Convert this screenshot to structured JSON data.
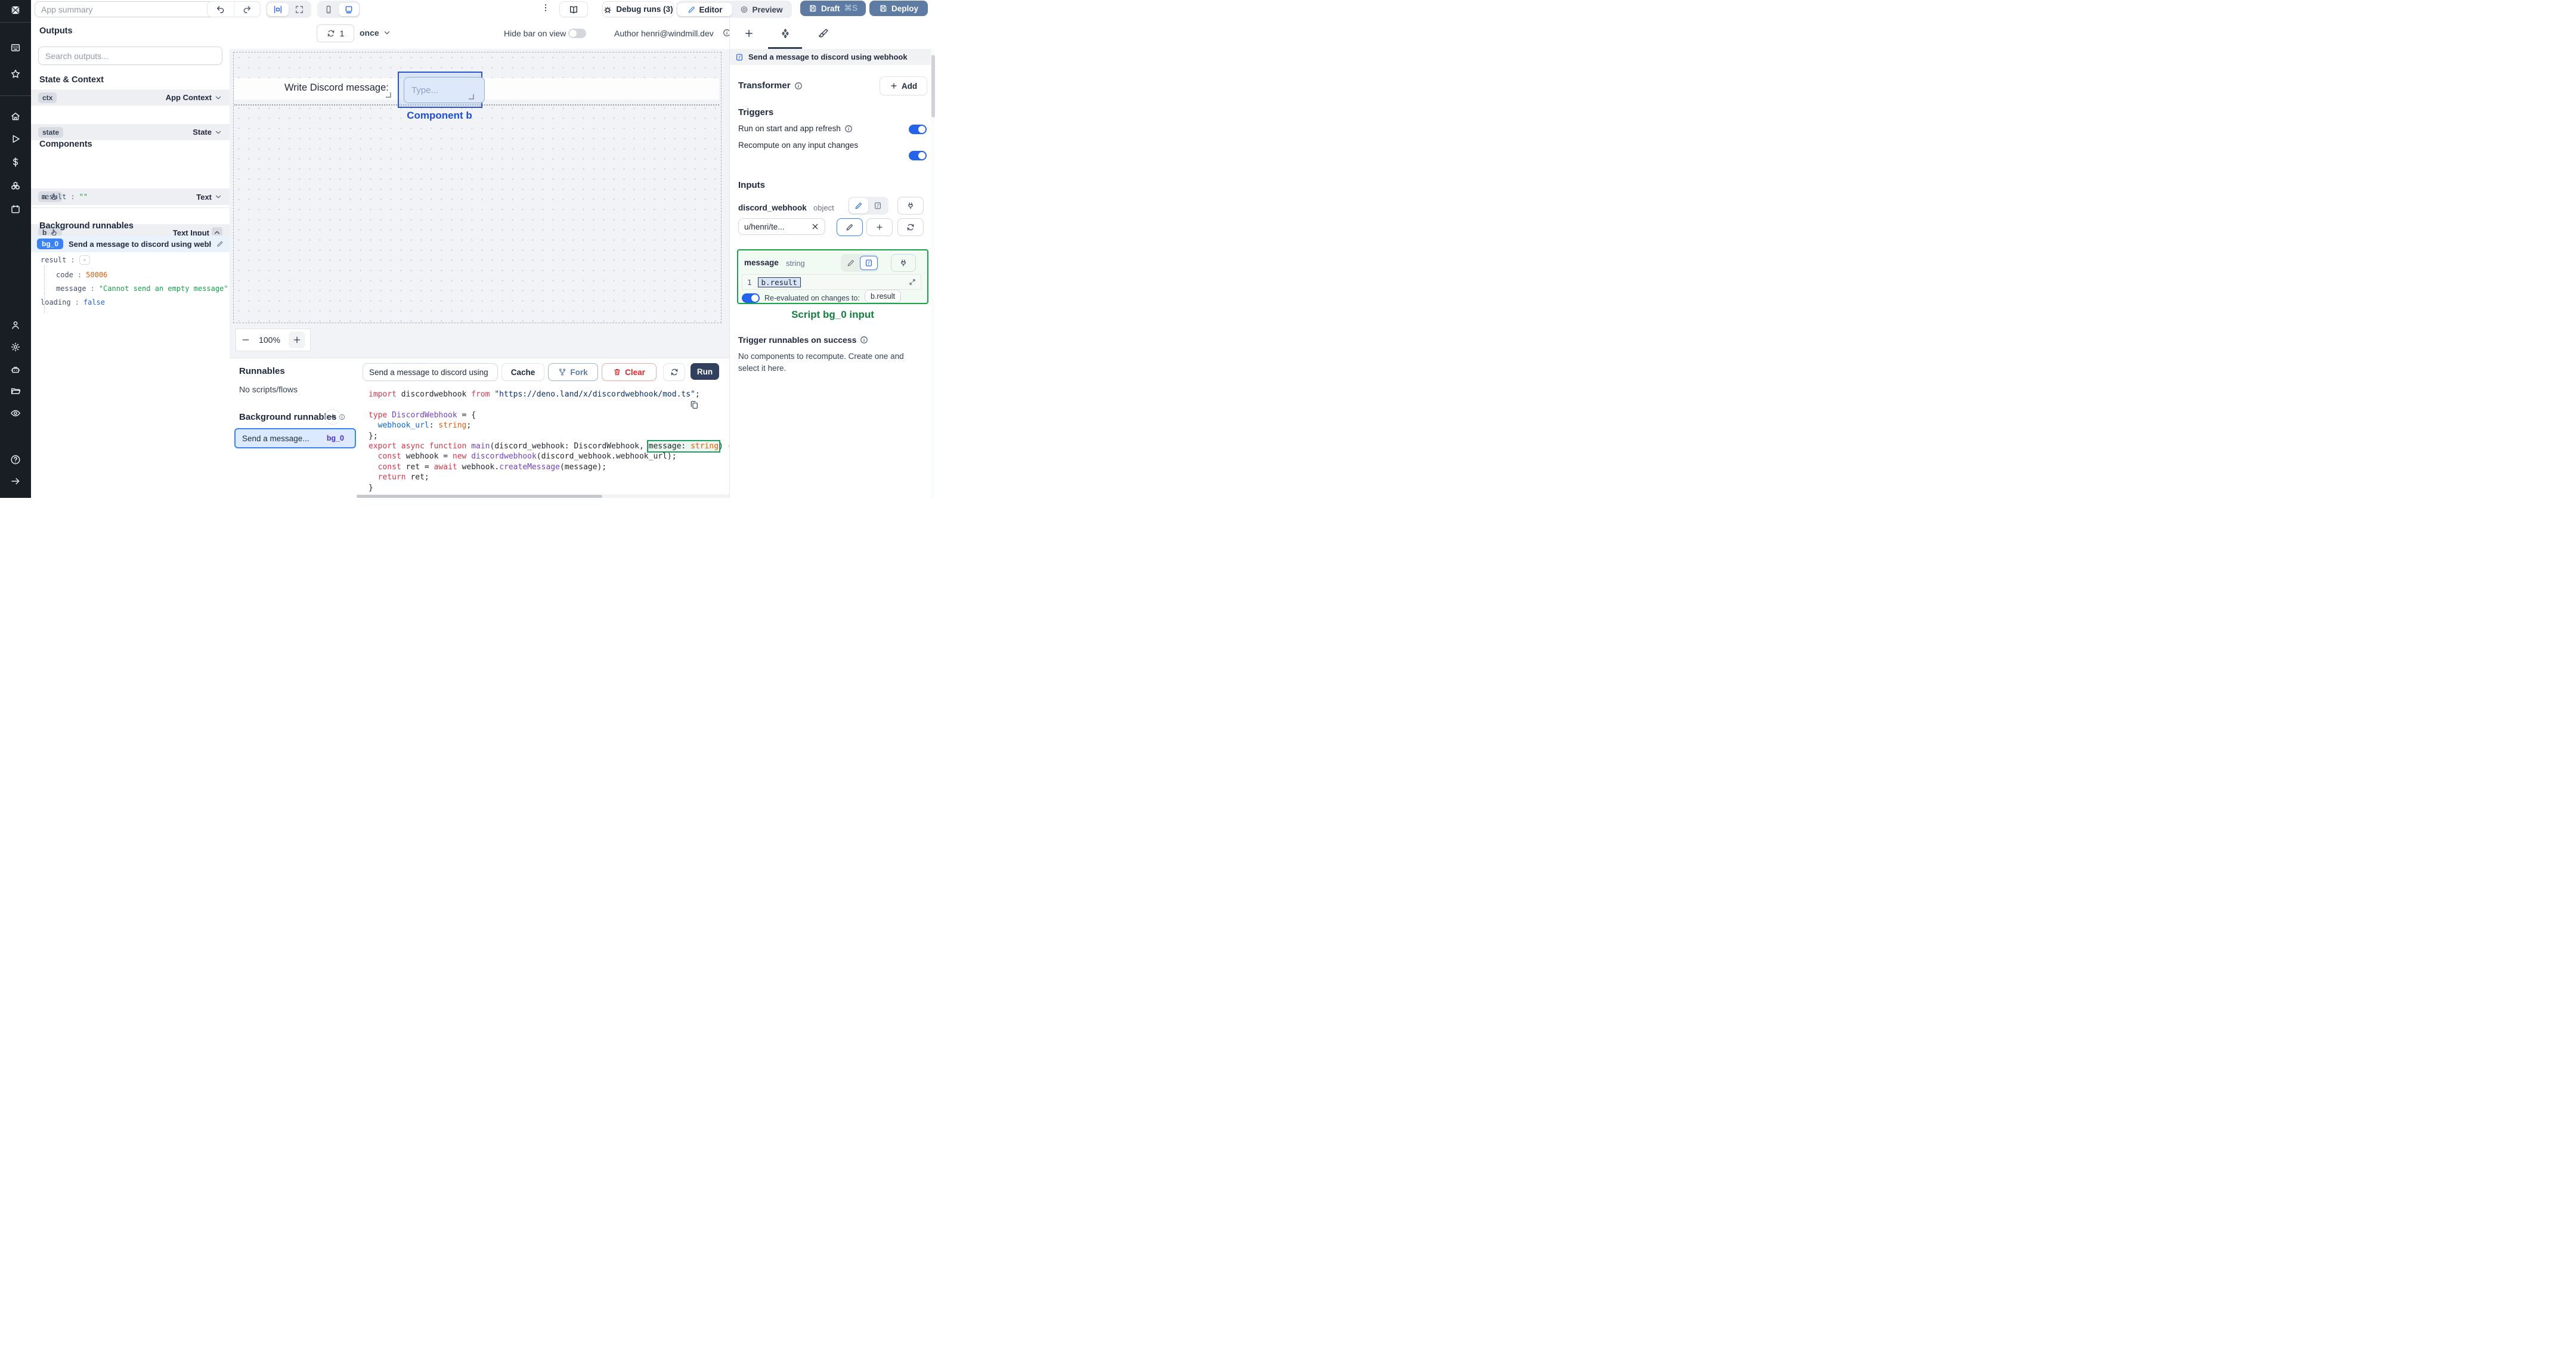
{
  "topbar": {
    "app_summary_placeholder": "App summary",
    "debug_runs_label": "Debug runs (3)",
    "editor_label": "Editor",
    "preview_label": "Preview",
    "draft_label": "Draft",
    "draft_shortcut": "⌘S",
    "deploy_label": "Deploy"
  },
  "canvas_bar": {
    "refresh_count": "1",
    "refresh_mode": "once",
    "hide_bar_label": "Hide bar on view",
    "author_label": "Author henri@windmill.dev"
  },
  "outputs": {
    "title": "Outputs",
    "search_placeholder": "Search outputs...",
    "state_context_title": "State & Context",
    "ctx": {
      "name": "ctx",
      "type": "App Context"
    },
    "state": {
      "name": "state",
      "type": "State"
    },
    "components_title": "Components",
    "comp_a": {
      "name": "a",
      "type": "Text"
    },
    "comp_b": {
      "name": "b",
      "type": "Text Input"
    },
    "comp_b_result": {
      "key": "result",
      "value": "\"\""
    },
    "background_title": "Background runnables",
    "bg0": {
      "badge": "bg_0",
      "label": "Send a message to discord using webhook"
    },
    "bg0_result": {
      "key": "result",
      "value": "-"
    },
    "bg0_code": {
      "key": "code",
      "value": "50006"
    },
    "bg0_message": {
      "key": "message",
      "value": "\"Cannot send an empty message\""
    },
    "bg0_loading": {
      "key": "loading",
      "value": "false"
    }
  },
  "canvas": {
    "component_a_text": "Write Discord message:",
    "component_b_placeholder": "Type...",
    "component_b_label": "Component b",
    "zoom_level": "100%"
  },
  "runnables": {
    "title": "Runnables",
    "empty_label": "No scripts/flows",
    "background_title": "Background runnables",
    "selected": {
      "label": "Send a message...",
      "badge": "bg_0"
    }
  },
  "code_panel": {
    "name_value": "Send a message to discord using",
    "cache_label": "Cache",
    "fork_label": "Fork",
    "clear_label": "Clear",
    "run_label": "Run",
    "lines": [
      [
        {
          "c": "kw",
          "t": "import"
        },
        {
          "c": "pl",
          "t": " discordwebhook "
        },
        {
          "c": "kw",
          "t": "from"
        },
        {
          "c": "str",
          "t": " \"https://deno.land/x/discordwebhook/mod.ts\""
        },
        {
          "c": "pl",
          "t": ";"
        }
      ],
      [],
      [
        {
          "c": "kw",
          "t": "type"
        },
        {
          "c": "fn",
          "t": " DiscordWebhook"
        },
        {
          "c": "pl",
          "t": " = {"
        }
      ],
      [
        {
          "c": "prop",
          "t": "  webhook_url"
        },
        {
          "c": "pl",
          "t": ": "
        },
        {
          "c": "typ",
          "t": "string"
        },
        {
          "c": "pl",
          "t": ";"
        }
      ],
      [
        {
          "c": "pl",
          "t": "};"
        }
      ],
      [
        {
          "c": "kw",
          "t": "export async function"
        },
        {
          "c": "fn",
          "t": " main"
        },
        {
          "c": "pl",
          "t": "(discord_webhook: DiscordWebhook, "
        },
        {
          "box": [
            {
              "c": "pl",
              "t": "message: "
            },
            {
              "c": "typ",
              "t": "string"
            }
          ]
        },
        {
          "c": "pl",
          "t": ") {"
        }
      ],
      [
        {
          "c": "pl",
          "t": "  "
        },
        {
          "c": "kw",
          "t": "const"
        },
        {
          "c": "pl",
          "t": " webhook = "
        },
        {
          "c": "kw",
          "t": "new"
        },
        {
          "c": "fn",
          "t": " discordwebhook"
        },
        {
          "c": "pl",
          "t": "(discord_webhook.webhook_url);"
        }
      ],
      [
        {
          "c": "pl",
          "t": "  "
        },
        {
          "c": "kw",
          "t": "const"
        },
        {
          "c": "pl",
          "t": " ret = "
        },
        {
          "c": "kw",
          "t": "await"
        },
        {
          "c": "pl",
          "t": " webhook."
        },
        {
          "c": "fn",
          "t": "createMessage"
        },
        {
          "c": "pl",
          "t": "(message);"
        }
      ],
      [
        {
          "c": "pl",
          "t": "  "
        },
        {
          "c": "kw",
          "t": "return"
        },
        {
          "c": "pl",
          "t": " ret;"
        }
      ],
      [
        {
          "c": "pl",
          "t": "}"
        }
      ]
    ]
  },
  "right_panel": {
    "header_title": "Send a message to discord using webhook",
    "transformer_label": "Transformer",
    "add_label": "Add",
    "triggers_title": "Triggers",
    "trigger_run_on_start": "Run on start and app refresh",
    "trigger_recompute": "Recompute on any input changes",
    "inputs_title": "Inputs",
    "discord_webhook": {
      "name": "discord_webhook",
      "type": "object",
      "value": "u/henri/te..."
    },
    "message": {
      "name": "message",
      "type": "string",
      "line_number": "1",
      "value": "b.result"
    },
    "reeval_label": "Re-evaluated on changes to:",
    "reeval_value": "b.result",
    "script_input_label": "Script bg_0 input",
    "trigger_success_title": "Trigger runnables on success",
    "no_components_text": "No components to recompute. Create one and select it here."
  },
  "colors": {
    "accent_blue": "#2563eb",
    "slate_button": "#5e7ca3",
    "run_button_navy": "#31405f",
    "annotation_green": "#16a34a",
    "error_orange": "#e8590c",
    "string_green": "#16a34a",
    "bool_blue": "#2563eb",
    "badge_indigo": "#4338ca"
  },
  "icons": {
    "windmill-logo-icon": "pinwheel",
    "apps-icon": "keypad",
    "star-icon": "☆",
    "home-icon": "⌂",
    "play-icon": "▷",
    "dollar-icon": "$",
    "boxes-icon": "cubes",
    "calendar-icon": "▦",
    "user-icon": "person",
    "settings-icon": "gear",
    "robot-icon": "robot",
    "folder-icon": "folder",
    "eye-icon": "eye",
    "help-icon": "?",
    "arrow-right-icon": "→",
    "undo-icon": "↶",
    "redo-icon": "↷",
    "align-icon": "|o|",
    "expand-icon": "⛶",
    "phone-icon": "▯",
    "desktop-icon": "▭",
    "kebab-icon": "⋮",
    "book-icon": "open-book",
    "bug-icon": "bug",
    "pencil-icon": "✎",
    "preview-icon": "◎",
    "save-icon": "💾",
    "refresh-icon": "⟳",
    "chevron-down-icon": "⌄",
    "chevron-up-icon": "⌃",
    "info-icon": "ⓘ",
    "hand-icon": "☝",
    "close-icon": "✕",
    "plus-icon": "+",
    "minus-icon": "−",
    "fork-icon": "git-fork",
    "trash-icon": "🗑",
    "diamonds-icon": "❖",
    "brush-icon": "🖌",
    "function-icon": "f",
    "plug-icon": "plug",
    "expand-small-icon": "⤢",
    "copy-icon": "⧉"
  }
}
